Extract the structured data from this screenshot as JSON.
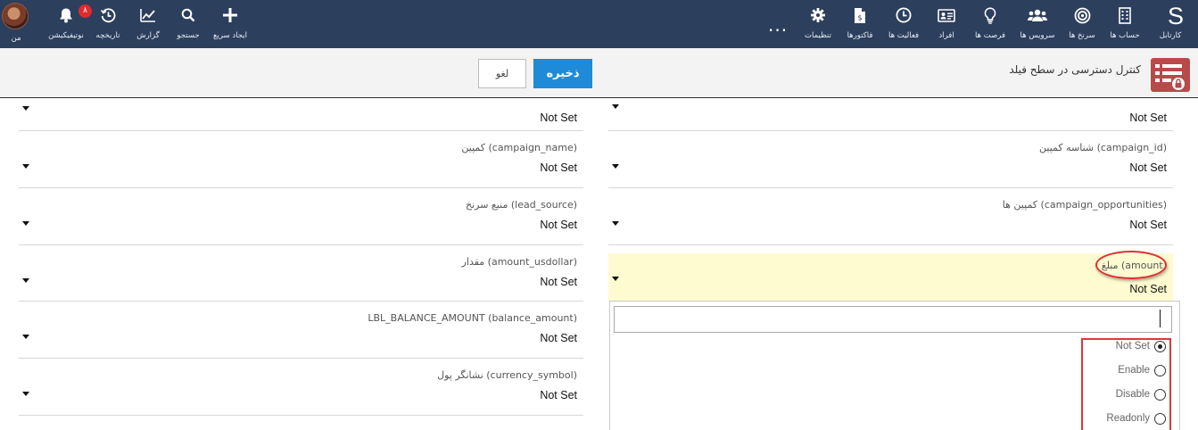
{
  "nav": {
    "brand": "S",
    "right_items": [
      {
        "label": "کارتابل",
        "icon": "s-logo-icon"
      },
      {
        "label": "حساب ها",
        "icon": "building-icon"
      },
      {
        "label": "سرنخ ها",
        "icon": "target-icon"
      },
      {
        "label": "سرویس ها",
        "icon": "users-icon"
      },
      {
        "label": "فرصت ها",
        "icon": "lightbulb-icon"
      },
      {
        "label": "افراد",
        "icon": "id-card-icon"
      },
      {
        "label": "فعالیت ها",
        "icon": "clock-icon"
      },
      {
        "label": "فاکتورها",
        "icon": "invoice-icon"
      },
      {
        "label": "تنظیمات",
        "icon": "gear-icon"
      }
    ],
    "more": "...",
    "left_items": [
      {
        "label": "ایجاد سریع",
        "icon": "plus-icon"
      },
      {
        "label": "جستجو",
        "icon": "search-icon"
      },
      {
        "label": "گزارش",
        "icon": "chart-icon"
      },
      {
        "label": "تاریخچه",
        "icon": "history-icon"
      },
      {
        "label": "نوتیفیکیشن",
        "icon": "bell-icon",
        "badge": "۸"
      }
    ],
    "user_label": "من"
  },
  "header": {
    "title": "کنترل دسترسی در سطح فیلد",
    "save_label": "ذخیره",
    "cancel_label": "لغو"
  },
  "fields_left": [
    {
      "label": "",
      "value": "Not Set"
    },
    {
      "label": "کمپین (campaign_name)",
      "value": "Not Set"
    },
    {
      "label": "منبع سرنخ (lead_source)",
      "value": "Not Set"
    },
    {
      "label": "مقدار (amount_usdollar)",
      "value": "Not Set"
    },
    {
      "label": "LBL_BALANCE_AMOUNT (balance_amount)",
      "value": "Not Set"
    },
    {
      "label": "نشانگر پول (currency_symbol)",
      "value": "Not Set"
    }
  ],
  "fields_right": [
    {
      "label": "",
      "value": "Not Set"
    },
    {
      "label": "شناسه کمپین (campaign_id)",
      "value": "Not Set"
    },
    {
      "label": "کمپین ها (campaign_opportunities)",
      "value": "Not Set"
    },
    {
      "label": "مبلغ (amount)",
      "value": "Not Set"
    }
  ],
  "dropdown": {
    "search_value": "",
    "options": [
      {
        "label": "Not Set",
        "selected": true
      },
      {
        "label": "Enable",
        "selected": false
      },
      {
        "label": "Disable",
        "selected": false
      },
      {
        "label": "Readonly",
        "selected": false
      }
    ]
  },
  "colors": {
    "nav_bg": "#2c3f5d",
    "save_button": "#1f8ad7",
    "highlight_row": "#fffbd1",
    "annotation_red": "#d83a3a",
    "page_icon_bg": "#b84a4a"
  }
}
